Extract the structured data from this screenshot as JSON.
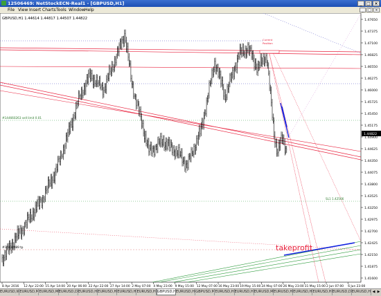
{
  "window": {
    "title": "12506469: NetStockECN-Real1 - [GBPUSD,H1]",
    "controls": [
      "_",
      "□",
      "×"
    ]
  },
  "menu": [
    "File",
    "View",
    "Insert",
    "Charts",
    "Tools",
    "Window",
    "Help"
  ],
  "mdi_controls": [
    "_",
    "□",
    "×"
  ],
  "chart": {
    "header": "GBPUSD,H1  1.44614 1.44817 1.44507 1.44822",
    "price_labels": [
      "1.47650",
      "1.47375",
      "1.47100",
      "1.46825",
      "1.46550",
      "1.46275",
      "1.46000",
      "1.45725",
      "1.45450",
      "1.45175",
      "1.44900",
      "1.44625",
      "1.44350",
      "1.44075",
      "1.43800",
      "1.43525",
      "1.43250",
      "1.42975",
      "1.42700",
      "1.42425",
      "1.42150",
      "1.41875",
      "1.41600"
    ],
    "current_price": "1.44822",
    "time_labels": [
      "8 Apr 2016",
      "12 Apr 22:00",
      "15 Apr 14:00",
      "20 Apr 06:00",
      "22 Apr 22:00",
      "27 Apr 14:00",
      "2 May 07:00",
      "4 May 23:00",
      "9 May 15:00",
      "12 May 07:00",
      "16 May 23:00",
      "19 May 15:00",
      "24 May 07:00",
      "26 May 23:00",
      "31 May 15:00",
      "2 Jun 07:00",
      "6 Jun 23:00"
    ],
    "annotations": {
      "sell_limit": "#144660263 sell limit 0.01",
      "hline_label": "#14434089 tp",
      "sl_label": "SL1 1.42566",
      "order_text_top": "Current",
      "order_text_bottom": "Position",
      "takeprofit": "takeprofit"
    },
    "colors": {
      "bull_bear_bars": "#000000",
      "red_lines": "#e8203c",
      "blue_dotted": "#4040c0",
      "green_lines": "#2a9a3a",
      "blue_trend": "#1020e0",
      "takeprofit_text": "#e8203c"
    }
  },
  "tabs": [
    {
      "label": "EURUSD,Weekly",
      "active": false
    },
    {
      "label": "EURUSD,M15",
      "active": false
    },
    {
      "label": "EURUSD,M30",
      "active": false
    },
    {
      "label": "EURUSD,Daily",
      "active": false
    },
    {
      "label": "EURUSD,H1",
      "active": false
    },
    {
      "label": "EURUSD,H1",
      "active": false
    },
    {
      "label": "EURUSD,H1",
      "active": false
    },
    {
      "label": "EURUSD,H1",
      "active": false
    },
    {
      "label": "GBPUSD,H1",
      "active": true
    },
    {
      "label": "EURUSD,H1",
      "active": false
    },
    {
      "label": "GBPUSD,M30",
      "active": false
    },
    {
      "label": "EURUSD,H1",
      "active": false
    },
    {
      "label": "EURUSD,H1",
      "active": false
    },
    {
      "label": "EURUSD,M1",
      "active": false
    },
    {
      "label": "EURUSD,H1",
      "active": false
    },
    {
      "label": "EURUSD,H1",
      "active": false
    },
    {
      "label": "EURUSD,H1",
      "active": false
    },
    {
      "label": "EURUSD,Daily",
      "active": false
    },
    {
      "label": "EURUSD,H1",
      "active": false
    }
  ]
}
